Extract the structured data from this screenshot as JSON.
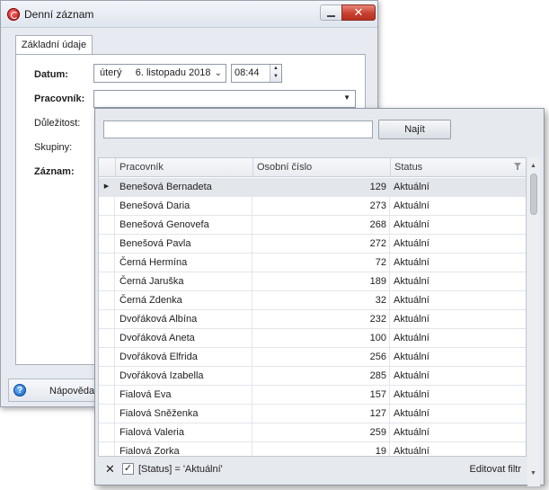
{
  "window": {
    "title": "Denní záznam",
    "close_glyph": "✕"
  },
  "tabs": [
    {
      "label": "Základní údaje"
    }
  ],
  "form": {
    "date_label": "Datum:",
    "date_value": "úterý     6. listopadu 2018",
    "time_value": "08:44",
    "employee_label": "Pracovník:",
    "importance_label": "Důležitost:",
    "groups_label": "Skupiny:",
    "record_label": "Záznam:"
  },
  "footer": {
    "help_label": "Nápověda",
    "help_glyph": "?"
  },
  "popup": {
    "search_value": "",
    "search_placeholder": "",
    "find_label": "Najít",
    "columns": [
      "Pracovník",
      "Osobní číslo",
      "Status"
    ],
    "rows": [
      {
        "name": "Benešová Bernadeta",
        "number": "129",
        "status": "Aktuální"
      },
      {
        "name": "Benešová Daria",
        "number": "273",
        "status": "Aktuální"
      },
      {
        "name": "Benešová Genovefa",
        "number": "268",
        "status": "Aktuální"
      },
      {
        "name": "Benešová Pavla",
        "number": "272",
        "status": "Aktuální"
      },
      {
        "name": "Černá Hermína",
        "number": "72",
        "status": "Aktuální"
      },
      {
        "name": "Černá Jaruška",
        "number": "189",
        "status": "Aktuální"
      },
      {
        "name": "Černá Zdenka",
        "number": "32",
        "status": "Aktuální"
      },
      {
        "name": "Dvořáková Albína",
        "number": "232",
        "status": "Aktuální"
      },
      {
        "name": "Dvořáková Aneta",
        "number": "100",
        "status": "Aktuální"
      },
      {
        "name": "Dvořáková Elfrida",
        "number": "256",
        "status": "Aktuální"
      },
      {
        "name": "Dvořáková Izabella",
        "number": "285",
        "status": "Aktuální"
      },
      {
        "name": "Fialová Eva",
        "number": "157",
        "status": "Aktuální"
      },
      {
        "name": "Fialová Sněženka",
        "number": "127",
        "status": "Aktuální"
      },
      {
        "name": "Fialová Valeria",
        "number": "259",
        "status": "Aktuální"
      },
      {
        "name": "Fialová Zorka",
        "number": "19",
        "status": "Aktuální"
      }
    ],
    "selected_index": 0,
    "filter_text": "[Status] = 'Aktuální'",
    "edit_filter_label": "Editovat filtr",
    "filter_clear_glyph": "✕",
    "filter_check_glyph": "✓"
  },
  "icons": {
    "app": "app-logo-icon",
    "minimize": "minimize-icon",
    "close": "close-icon",
    "help": "help-icon",
    "filter": "funnel-icon"
  },
  "colors": {
    "close_button": "#c8402f",
    "help_icon": "#1260c2",
    "selected_row": "#e3e6eb"
  }
}
